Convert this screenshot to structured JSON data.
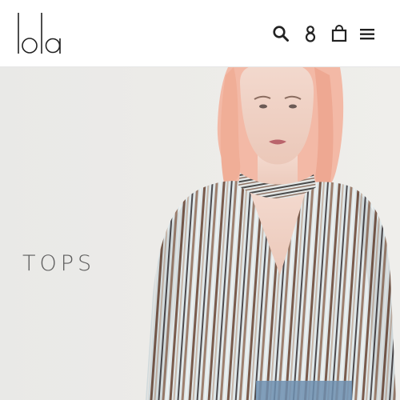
{
  "brand": {
    "logo_text": "lola"
  },
  "header": {
    "icons": [
      "search-icon",
      "account-icon",
      "cart-icon",
      "menu-icon"
    ]
  },
  "hero": {
    "title": "TOPS"
  },
  "colors": {
    "header_bg": "#ffffff",
    "hero_bg": "#ecebe8",
    "title_text": "#5d5d5d",
    "icon": "#222222"
  }
}
